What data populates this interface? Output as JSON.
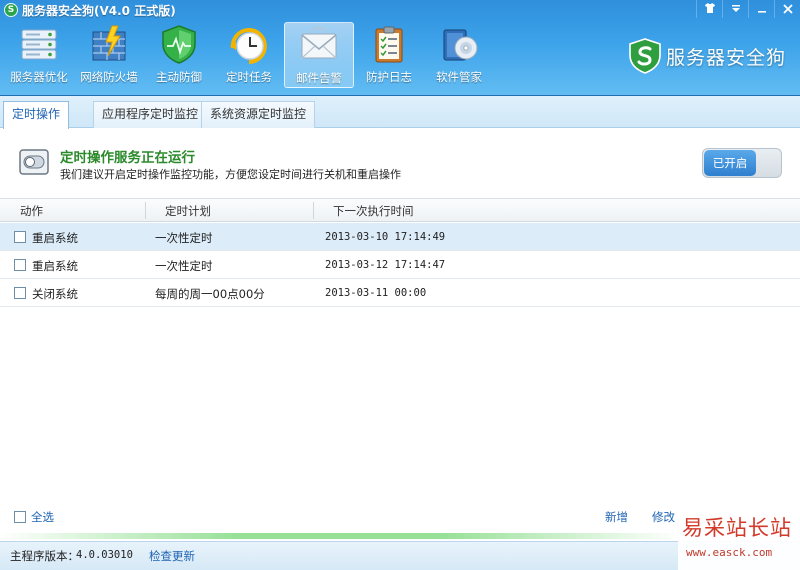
{
  "window": {
    "title": "服务器安全狗(V4.0 正式版)",
    "logo_letter": "S",
    "controls": [
      "shirt-icon",
      "menu-icon",
      "minimize-icon",
      "close-icon"
    ]
  },
  "toolbar": {
    "items": [
      {
        "label": "服务器优化",
        "icon": "server-optimize-icon"
      },
      {
        "label": "网络防火墙",
        "icon": "firewall-icon"
      },
      {
        "label": "主动防御",
        "icon": "shield-icon"
      },
      {
        "label": "定时任务",
        "icon": "clock-icon"
      },
      {
        "label": "邮件告警",
        "icon": "mail-icon",
        "active": true
      },
      {
        "label": "防护日志",
        "icon": "log-clipboard-icon"
      },
      {
        "label": "软件管家",
        "icon": "software-disc-icon"
      }
    ]
  },
  "brand": {
    "text": "服务器安全狗",
    "badge": "S"
  },
  "subtabs": [
    {
      "label": "定时操作",
      "active": true
    },
    {
      "label": "应用程序定时监控"
    },
    {
      "label": "系统资源定时监控"
    }
  ],
  "status": {
    "title": "定时操作服务正在运行",
    "description": "我们建议开启定时操作监控功能，方便您设定时间进行关机和重启操作",
    "toggle_label": "已开启"
  },
  "table": {
    "columns": [
      "动作",
      "定时计划",
      "下一次执行时间"
    ],
    "rows": [
      {
        "action": "重启系统",
        "plan": "一次性定时",
        "next": "2013-03-10 17:14:49",
        "selected": true
      },
      {
        "action": "重启系统",
        "plan": "一次性定时",
        "next": "2013-03-12 17:14:47"
      },
      {
        "action": "关闭系统",
        "plan": "每周的周一00点00分",
        "next": "2013-03-11 00:00"
      }
    ]
  },
  "footer": {
    "select_all": "全选",
    "add": "新增",
    "edit": "修改"
  },
  "statusbar": {
    "version_label": "主程序版本：",
    "version": "4.0.03010",
    "check_update": "检查更新"
  },
  "watermark": {
    "text": "易采站长站",
    "url": "www.easck.com"
  },
  "colors": {
    "header_blue": "#3da3ea",
    "status_green": "#2c8a2c",
    "link_blue": "#1e63b4",
    "toggle_blue": "#2e7fcf",
    "selected_row": "#dcecf9"
  }
}
